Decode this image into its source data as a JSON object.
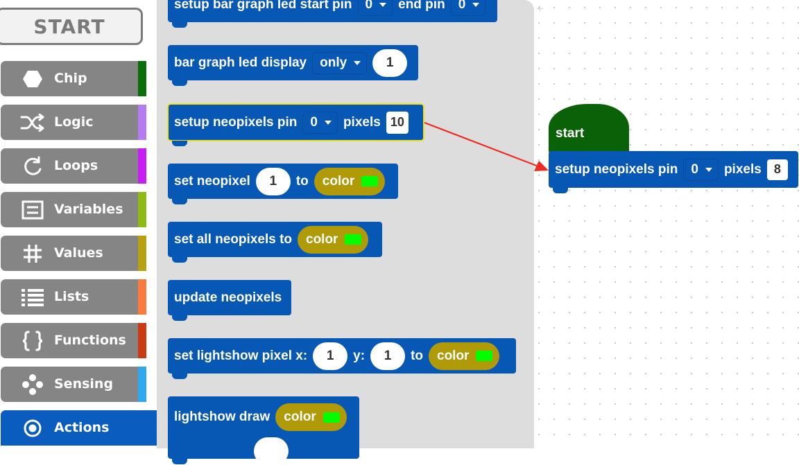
{
  "sidebar": {
    "start_label": "START",
    "categories": [
      {
        "label": "Chip",
        "icon": "hexagon-icon",
        "color": "#0b6e0a"
      },
      {
        "label": "Logic",
        "icon": "shuffle-icon",
        "color": "#b57bf3"
      },
      {
        "label": "Loops",
        "icon": "loop-arrow-icon",
        "color": "#c61ef5"
      },
      {
        "label": "Variables",
        "icon": "variables-icon",
        "color": "#8dbb11"
      },
      {
        "label": "Values",
        "icon": "hash-icon",
        "color": "#b8a10e"
      },
      {
        "label": "Lists",
        "icon": "list-icon",
        "color": "#fb7b3e"
      },
      {
        "label": "Functions",
        "icon": "braces-icon",
        "color": "#cc3a12"
      },
      {
        "label": "Sensing",
        "icon": "sensing-dots-icon",
        "color": "#2ea9f0"
      },
      {
        "label": "Actions",
        "icon": "target-icon",
        "color": "#0b5cbf",
        "active": true
      }
    ]
  },
  "flyout": {
    "b1": {
      "t1": "setup bar graph led start pin",
      "start_pin": "0",
      "t2": "end pin",
      "end_pin": "0"
    },
    "b2": {
      "t1": "bar graph led display",
      "mode": "only",
      "value": "1"
    },
    "b3": {
      "t1": "setup neopixels pin",
      "pin": "0",
      "t2": "pixels",
      "pixels": "10"
    },
    "b4": {
      "t1": "set neopixel",
      "index": "1",
      "t2": "to",
      "color_label": "color"
    },
    "b5": {
      "t1": "set all neopixels to",
      "color_label": "color"
    },
    "b6": {
      "t1": "update neopixels"
    },
    "b7": {
      "t1": "set lightshow pixel x:",
      "x": "1",
      "t2": "y:",
      "y": "1",
      "t3": "to",
      "color_label": "color"
    },
    "b8": {
      "t1": "lightshow draw",
      "color_label": "color"
    }
  },
  "workspace": {
    "hat_label": "start",
    "block": {
      "t1": "setup neopixels pin",
      "pin": "0",
      "t2": "pixels",
      "pixels": "8"
    }
  },
  "colors": {
    "block_blue": "#0758b5",
    "hat_green": "#0a6108",
    "color_pill": "#b09a08",
    "swatch_green": "#00ff00",
    "arrow_red": "#f02a1e",
    "flyout_bg": "#dddddd"
  }
}
